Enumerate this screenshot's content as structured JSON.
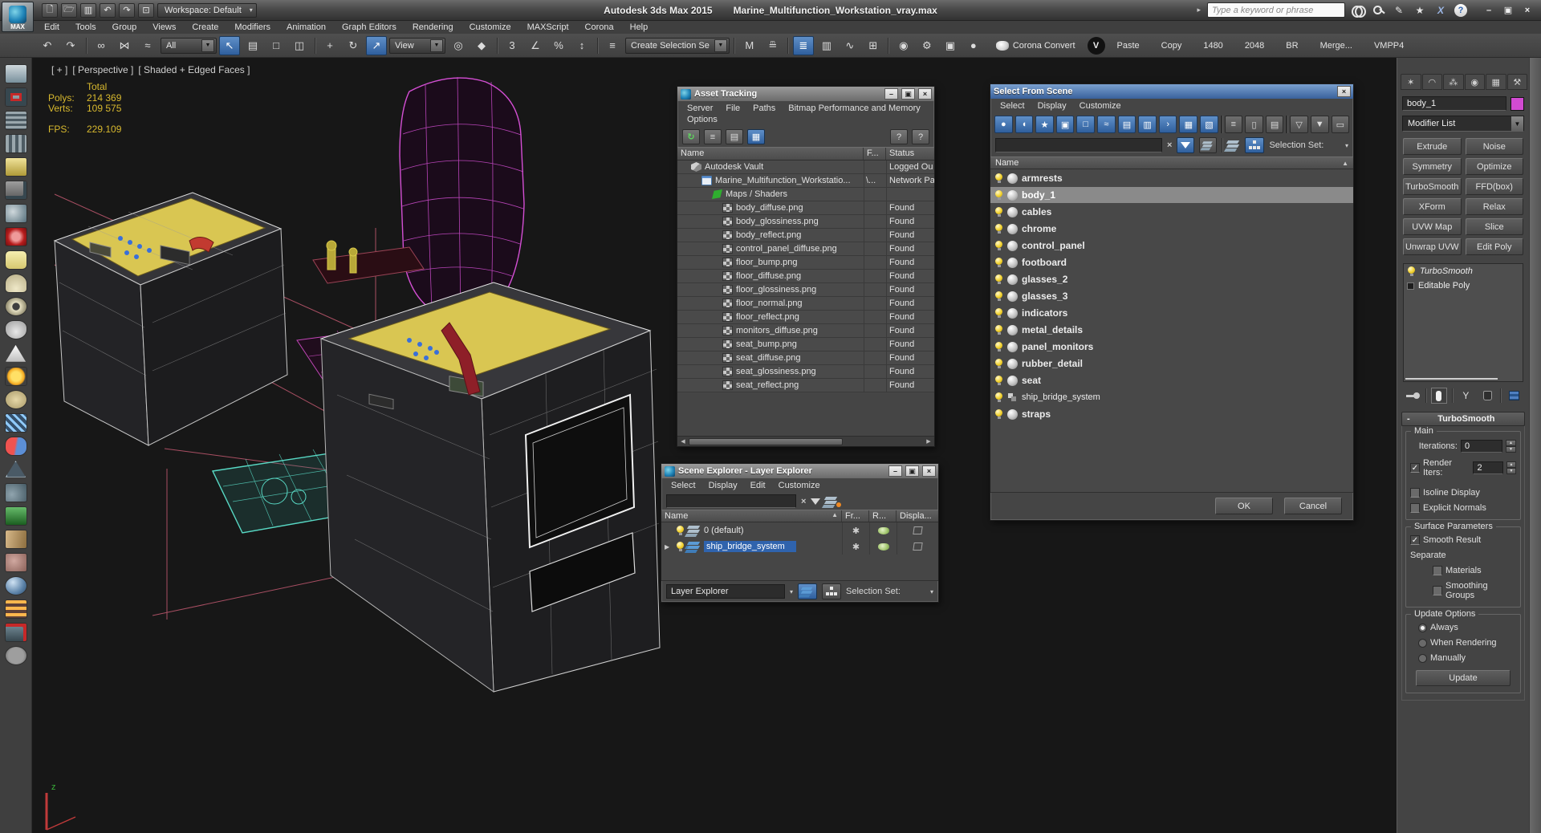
{
  "icons": {
    "close": "×",
    "minimize": "–",
    "maximize": "▣",
    "dropdown": "▼",
    "dropdown_small": "▾",
    "sort_asc": "▲",
    "expand": "▶",
    "check": "✓",
    "snowflake": "✱",
    "clear": "×",
    "scroll_left": "◀",
    "scroll_right": "▶",
    "help": "?",
    "nav_arrow": "▸"
  },
  "app": {
    "logo_label": "MAX",
    "title_app": "Autodesk 3ds Max  2015",
    "title_file": "Marine_Multifunction_Workstation_vray.max",
    "workspace": "Workspace: Default",
    "search_placeholder": "Type a keyword or phrase",
    "menus": [
      {
        "label": "Edit"
      },
      {
        "label": "Tools"
      },
      {
        "label": "Group"
      },
      {
        "label": "Views"
      },
      {
        "label": "Create"
      },
      {
        "label": "Modifiers"
      },
      {
        "label": "Animation"
      },
      {
        "label": "Graph Editors"
      },
      {
        "label": "Rendering"
      },
      {
        "label": "Customize"
      },
      {
        "label": "MAXScript"
      },
      {
        "label": "Corona"
      },
      {
        "label": "Help"
      }
    ]
  },
  "toolbar": {
    "items": [
      {
        "name": "undo-icon",
        "kind": "ico",
        "glyph": "↶"
      },
      {
        "name": "redo-icon",
        "kind": "ico",
        "glyph": "↷"
      },
      {
        "name": "sep",
        "kind": "sep"
      },
      {
        "name": "link-icon",
        "kind": "ico",
        "glyph": "∞"
      },
      {
        "name": "unlink-icon",
        "kind": "ico",
        "glyph": "⋈"
      },
      {
        "name": "bind-spacewarp-icon",
        "kind": "ico",
        "glyph": "≈"
      },
      {
        "name": "selection-filter-dropdown",
        "kind": "dd",
        "dropdown": "All"
      },
      {
        "name": "select-object-icon",
        "kind": "ico active",
        "glyph": "↖"
      },
      {
        "name": "select-by-name-icon",
        "kind": "ico",
        "glyph": "▤"
      },
      {
        "name": "rect-selection-icon",
        "kind": "ico",
        "glyph": "□"
      },
      {
        "name": "window-crossing-icon",
        "kind": "ico",
        "glyph": "◫"
      },
      {
        "name": "sep",
        "kind": "sep"
      },
      {
        "name": "move-icon",
        "kind": "ico",
        "glyph": "+"
      },
      {
        "name": "rotate-icon",
        "kind": "ico",
        "glyph": "↻"
      },
      {
        "name": "scale-icon",
        "kind": "ico active",
        "glyph": "↗"
      },
      {
        "name": "ref-coord-dropdown",
        "kind": "dd",
        "dropdown": "View"
      },
      {
        "name": "pivot-center-icon",
        "kind": "ico",
        "glyph": "◎"
      },
      {
        "name": "manipulate-icon",
        "kind": "ico",
        "glyph": "◆"
      },
      {
        "name": "sep",
        "kind": "sep"
      },
      {
        "name": "snap-3d-icon",
        "kind": "ico",
        "glyph": "3"
      },
      {
        "name": "angle-snap-icon",
        "kind": "ico",
        "glyph": "∠"
      },
      {
        "name": "percent-snap-icon",
        "kind": "ico",
        "glyph": "%"
      },
      {
        "name": "spinner-snap-icon",
        "kind": "ico",
        "glyph": "↕"
      },
      {
        "name": "sep",
        "kind": "sep"
      },
      {
        "name": "named-selection-icon",
        "kind": "ico",
        "glyph": "≡"
      },
      {
        "name": "selection-set-dropdown",
        "kind": "dd",
        "dropdown": "Create Selection Se"
      },
      {
        "name": "sep",
        "kind": "sep"
      },
      {
        "name": "mirror-icon",
        "kind": "ico",
        "glyph": "M"
      },
      {
        "name": "align-icon",
        "kind": "ico",
        "glyph": "≞"
      },
      {
        "name": "sep",
        "kind": "sep"
      },
      {
        "name": "layer-manager-icon",
        "kind": "ico active",
        "glyph": "≣"
      },
      {
        "name": "toolbox-icon",
        "kind": "ico",
        "glyph": "▥"
      },
      {
        "name": "curve-editor-icon",
        "kind": "ico",
        "glyph": "∿"
      },
      {
        "name": "schematic-view-icon",
        "kind": "ico",
        "glyph": "⊞"
      },
      {
        "name": "sep",
        "kind": "sep"
      },
      {
        "name": "material-editor-icon",
        "kind": "ico",
        "glyph": "◉"
      },
      {
        "name": "render-setup-icon",
        "kind": "ico",
        "glyph": "⚙"
      },
      {
        "name": "rendered-frame-icon",
        "kind": "ico",
        "glyph": "▣"
      },
      {
        "name": "render-production-icon",
        "kind": "ico",
        "glyph": "●"
      },
      {
        "name": "corona-convert-button",
        "kind": "txt corona",
        "label": "Corona Convert"
      },
      {
        "name": "corona-vfb-icon",
        "kind": "vfb",
        "glyph": "V"
      },
      {
        "name": "paste-button",
        "kind": "txt",
        "label": "Paste"
      },
      {
        "name": "copy-button",
        "kind": "txt",
        "label": "Copy"
      },
      {
        "name": "res-1480-button",
        "kind": "txt",
        "label": "1480"
      },
      {
        "name": "res-2048-button",
        "kind": "txt",
        "label": "2048"
      },
      {
        "name": "br-button",
        "kind": "txt",
        "label": "BR"
      },
      {
        "name": "merge-button",
        "kind": "txt",
        "label": "Merge..."
      },
      {
        "name": "vmpp4-button",
        "kind": "txt",
        "label": "VMPP4"
      }
    ]
  },
  "left_toolbar": {
    "items": [
      {
        "name": "render-preview-icon",
        "icon": "lt-monitor"
      },
      {
        "name": "framebuffer-icon",
        "icon": "lt-screen-red"
      },
      {
        "name": "control-panel-icon",
        "icon": "lt-panel1"
      },
      {
        "name": "control-table-icon",
        "icon": "lt-panel2"
      },
      {
        "name": "light-device-icon",
        "icon": "lt-lamp"
      },
      {
        "name": "camera-audio-icon",
        "icon": "lt-cam"
      },
      {
        "name": "headlight-icon",
        "icon": "lt-shell"
      },
      {
        "name": "lens-rings-icon",
        "icon": "lt-rings"
      },
      {
        "name": "plate-icon",
        "icon": "lt-plate"
      },
      {
        "name": "dome-icon",
        "icon": "lt-dome"
      },
      {
        "name": "ring-icon",
        "icon": "lt-ring"
      },
      {
        "name": "teapot-icon",
        "icon": "lt-teapot"
      },
      {
        "name": "mound-icon",
        "icon": "lt-mound"
      },
      {
        "name": "sun-icon",
        "icon": "lt-sun"
      },
      {
        "name": "disc-icon",
        "icon": "lt-disc"
      },
      {
        "name": "scatter-icon",
        "icon": "lt-scatter"
      },
      {
        "name": "pills-icon",
        "icon": "lt-pills"
      },
      {
        "name": "pyramid-icon",
        "icon": "lt-pyramid"
      },
      {
        "name": "rocks-icon",
        "icon": "lt-rocks"
      },
      {
        "name": "grass-icon",
        "icon": "lt-grass"
      },
      {
        "name": "hair-icon",
        "icon": "lt-hair"
      },
      {
        "name": "brain-icon",
        "icon": "lt-brain"
      },
      {
        "name": "sphere-icon",
        "icon": "lt-sphere"
      },
      {
        "name": "panel-grid-icon",
        "icon": "lt-panelgrid"
      },
      {
        "name": "export-icon",
        "icon": "lt-export"
      },
      {
        "name": "help-icon",
        "icon": "lt-help"
      }
    ]
  },
  "viewport": {
    "label_nav": "[ + ]",
    "label_view": "[ Perspective ]",
    "label_shading": "[ Shaded + Edged Faces ]",
    "stats": {
      "total": "Total",
      "polys_label": "Polys:",
      "polys": "214 369",
      "verts_label": "Verts:",
      "verts": "109 575",
      "fps_label": "FPS:",
      "fps": "229.109"
    }
  },
  "asset_tracking": {
    "title": "Asset Tracking",
    "menu": [
      {
        "label": "Server"
      },
      {
        "label": "File"
      },
      {
        "label": "Paths"
      },
      {
        "label": "Bitmap Performance and Memory"
      },
      {
        "label": "Options"
      }
    ],
    "columns": {
      "name": "Name",
      "flags": "F...",
      "status": "Status"
    },
    "rows": [
      {
        "name": "Autodesk Vault",
        "flags": "",
        "status": "Logged Ou",
        "icon": "ic-vault",
        "indent": 1
      },
      {
        "name": "Marine_Multifunction_Workstatio...",
        "flags": "\\...",
        "status": "Network Pa",
        "icon": "ic-file",
        "indent": 2
      },
      {
        "name": "Maps / Shaders",
        "flags": "",
        "status": "",
        "icon": "ic-maps",
        "indent": 3
      },
      {
        "name": "body_diffuse.png",
        "flags": "",
        "status": "Found",
        "icon": "ic-map",
        "indent": 4
      },
      {
        "name": "body_glossiness.png",
        "flags": "",
        "status": "Found",
        "icon": "ic-map",
        "indent": 4
      },
      {
        "name": "body_reflect.png",
        "flags": "",
        "status": "Found",
        "icon": "ic-map",
        "indent": 4
      },
      {
        "name": "control_panel_diffuse.png",
        "flags": "",
        "status": "Found",
        "icon": "ic-map",
        "indent": 4
      },
      {
        "name": "floor_bump.png",
        "flags": "",
        "status": "Found",
        "icon": "ic-map",
        "indent": 4
      },
      {
        "name": "floor_diffuse.png",
        "flags": "",
        "status": "Found",
        "icon": "ic-map",
        "indent": 4
      },
      {
        "name": "floor_glossiness.png",
        "flags": "",
        "status": "Found",
        "icon": "ic-map",
        "indent": 4
      },
      {
        "name": "floor_normal.png",
        "flags": "",
        "status": "Found",
        "icon": "ic-map",
        "indent": 4
      },
      {
        "name": "floor_reflect.png",
        "flags": "",
        "status": "Found",
        "icon": "ic-map",
        "indent": 4
      },
      {
        "name": "monitors_diffuse.png",
        "flags": "",
        "status": "Found",
        "icon": "ic-map",
        "indent": 4
      },
      {
        "name": "seat_bump.png",
        "flags": "",
        "status": "Found",
        "icon": "ic-map",
        "indent": 4
      },
      {
        "name": "seat_diffuse.png",
        "flags": "",
        "status": "Found",
        "icon": "ic-map",
        "indent": 4
      },
      {
        "name": "seat_glossiness.png",
        "flags": "",
        "status": "Found",
        "icon": "ic-map",
        "indent": 4
      },
      {
        "name": "seat_reflect.png",
        "flags": "",
        "status": "Found",
        "icon": "ic-map",
        "indent": 4
      }
    ]
  },
  "scene_explorer": {
    "title": "Scene Explorer - Layer Explorer",
    "menu": [
      {
        "label": "Select"
      },
      {
        "label": "Display"
      },
      {
        "label": "Edit"
      },
      {
        "label": "Customize"
      }
    ],
    "columns": {
      "name": "Name",
      "frozen": "Fr...",
      "render": "R...",
      "display": "Displa..."
    },
    "rows": [
      {
        "name": "0 (default)",
        "layer_icon": "gray"
      },
      {
        "name": "ship_bridge_system",
        "selected": true,
        "expand": true,
        "layer_icon": "blue"
      }
    ],
    "footer": {
      "mode": "Layer Explorer",
      "selection_set_label": "Selection Set:"
    }
  },
  "select_from_scene": {
    "title": "Select From Scene",
    "menu": [
      {
        "label": "Select"
      },
      {
        "label": "Display"
      },
      {
        "label": "Customize"
      }
    ],
    "toolbar_icons": [
      {
        "name": "display-geometry-icon",
        "style": "blue",
        "glyph": "●"
      },
      {
        "name": "display-shapes-icon",
        "style": "blue",
        "glyph": "◖"
      },
      {
        "name": "display-lights-icon",
        "style": "blue",
        "glyph": "★"
      },
      {
        "name": "display-cameras-icon",
        "style": "blue",
        "glyph": "▣"
      },
      {
        "name": "display-helpers-icon",
        "style": "blue",
        "glyph": "□"
      },
      {
        "name": "display-spacewarps-icon",
        "style": "blue",
        "glyph": "≈"
      },
      {
        "name": "display-groups-icon",
        "style": "blue",
        "glyph": "▤"
      },
      {
        "name": "display-xrefs-icon",
        "style": "blue",
        "glyph": "▥"
      },
      {
        "name": "display-bones-icon",
        "style": "blue",
        "glyph": "›"
      },
      {
        "name": "display-containers-icon",
        "style": "blue",
        "glyph": "▦"
      },
      {
        "name": "display-assemblies-icon",
        "style": "blue",
        "glyph": "▧"
      },
      {
        "name": "sep",
        "style": "sepv",
        "glyph": ""
      },
      {
        "name": "list-view-icon",
        "style": "gray",
        "glyph": "≡"
      },
      {
        "name": "column-view-icon",
        "style": "gray",
        "glyph": "▯"
      },
      {
        "name": "detail-view-icon",
        "style": "gray",
        "glyph": "▤"
      },
      {
        "name": "sep",
        "style": "sepv",
        "glyph": ""
      },
      {
        "name": "filter-icon",
        "style": "gray",
        "glyph": "▽"
      },
      {
        "name": "filter-save-icon",
        "style": "gray",
        "glyph": "▼"
      },
      {
        "name": "filter-config-icon",
        "style": "gray",
        "glyph": "▭"
      }
    ],
    "search_value": "",
    "selection_set_label": "Selection Set:",
    "column_name": "Name",
    "rows": [
      {
        "name": "armrests",
        "icon2": "ic-sphere"
      },
      {
        "name": "body_1",
        "icon2": "ic-sphere",
        "selected": true
      },
      {
        "name": "cables",
        "icon2": "ic-sphere"
      },
      {
        "name": "chrome",
        "icon2": "ic-sphere"
      },
      {
        "name": "control_panel",
        "icon2": "ic-sphere"
      },
      {
        "name": "footboard",
        "icon2": "ic-sphere"
      },
      {
        "name": "glasses_2",
        "icon2": "ic-sphere"
      },
      {
        "name": "glasses_3",
        "icon2": "ic-sphere"
      },
      {
        "name": "indicators",
        "icon2": "ic-sphere"
      },
      {
        "name": "metal_details",
        "icon2": "ic-sphere"
      },
      {
        "name": "panel_monitors",
        "icon2": "ic-sphere"
      },
      {
        "name": "rubber_detail",
        "icon2": "ic-sphere"
      },
      {
        "name": "seat",
        "icon2": "ic-sphere"
      },
      {
        "name": "ship_bridge_system",
        "icon2": "ic-grp",
        "plain": true
      },
      {
        "name": "straps",
        "icon2": "ic-sphere"
      }
    ],
    "ok_label": "OK",
    "cancel_label": "Cancel"
  },
  "command_panel": {
    "tabs": [
      {
        "name": "tab-create",
        "glyph": "✶"
      },
      {
        "name": "tab-modify",
        "glyph": "◠",
        "selected": true
      },
      {
        "name": "tab-hierarchy",
        "glyph": "⁂"
      },
      {
        "name": "tab-motion",
        "glyph": "◉"
      },
      {
        "name": "tab-display",
        "glyph": "▦"
      },
      {
        "name": "tab-utilities",
        "glyph": "⚒"
      }
    ],
    "object_name": "body_1",
    "object_color": "#d24bd2",
    "modifier_list_label": "Modifier List",
    "modifier_buttons": [
      {
        "label": "Extrude"
      },
      {
        "label": "Noise"
      },
      {
        "label": "Symmetry"
      },
      {
        "label": "Optimize"
      },
      {
        "label": "TurboSmooth"
      },
      {
        "label": "FFD(box)"
      },
      {
        "label": "XForm"
      },
      {
        "label": "Relax"
      },
      {
        "label": "UVW Map"
      },
      {
        "label": "Slice"
      },
      {
        "label": "Unwrap UVW"
      },
      {
        "label": "Edit Poly"
      }
    ],
    "stack": [
      {
        "label": "TurboSmooth",
        "italic": true
      },
      {
        "label": "Editable Poly"
      }
    ],
    "rollout": {
      "title": "TurboSmooth",
      "main_label": "Main",
      "iterations_label": "Iterations:",
      "iterations_value": "0",
      "render_iters_label": "Render Iters:",
      "render_iters_value": "2",
      "render_iters_checked": true,
      "isoline_label": "Isoline Display",
      "isoline_checked": false,
      "explicit_label": "Explicit Normals",
      "explicit_checked": false,
      "surface_label": "Surface Parameters",
      "smooth_result_label": "Smooth Result",
      "smooth_result_checked": true,
      "separate_label": "Separate",
      "materials_label": "Materials",
      "materials_checked": false,
      "smoothing_groups_label": "Smoothing Groups",
      "smoothing_groups_checked": false,
      "update_label": "Update Options",
      "always_label": "Always",
      "always_on": true,
      "when_rendering_label": "When Rendering",
      "manually_label": "Manually",
      "update_button": "Update"
    }
  }
}
